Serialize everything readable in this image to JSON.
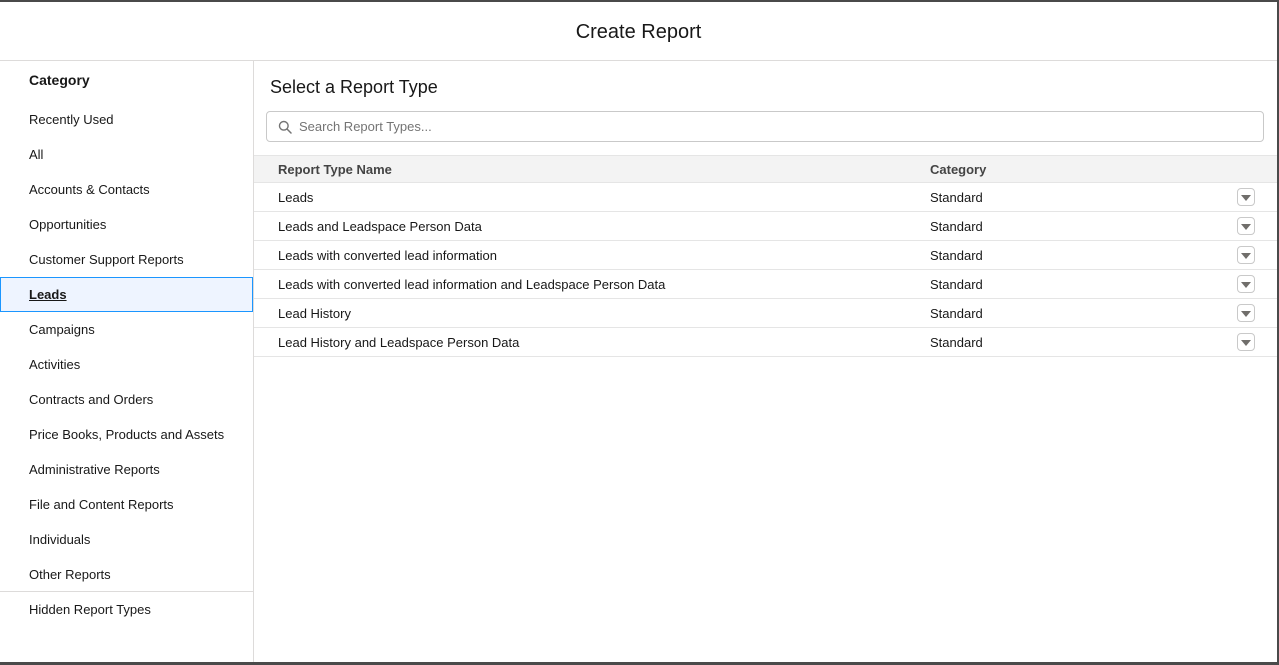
{
  "modal": {
    "title": "Create Report"
  },
  "sidebar": {
    "heading": "Category",
    "items": [
      {
        "label": "Recently Used"
      },
      {
        "label": "All"
      },
      {
        "label": "Accounts & Contacts"
      },
      {
        "label": "Opportunities"
      },
      {
        "label": "Customer Support Reports"
      },
      {
        "label": "Leads",
        "selected": true
      },
      {
        "label": "Campaigns"
      },
      {
        "label": "Activities"
      },
      {
        "label": "Contracts and Orders"
      },
      {
        "label": "Price Books, Products and Assets"
      },
      {
        "label": "Administrative Reports"
      },
      {
        "label": "File and Content Reports"
      },
      {
        "label": "Individuals"
      },
      {
        "label": "Other Reports"
      }
    ],
    "hidden_item": {
      "label": "Hidden Report Types"
    }
  },
  "main": {
    "title": "Select a Report Type",
    "search": {
      "placeholder": "Search Report Types...",
      "value": ""
    },
    "table": {
      "columns": [
        "Report Type Name",
        "Category"
      ],
      "rows": [
        {
          "name": "Leads",
          "category": "Standard"
        },
        {
          "name": "Leads and Leadspace Person Data",
          "category": "Standard"
        },
        {
          "name": "Leads with converted lead information",
          "category": "Standard"
        },
        {
          "name": "Leads with converted lead information and Leadspace Person Data",
          "category": "Standard"
        },
        {
          "name": "Lead History",
          "category": "Standard"
        },
        {
          "name": "Lead History and Leadspace Person Data",
          "category": "Standard"
        }
      ]
    }
  },
  "icons": {
    "search": "search-icon",
    "row_menu": "chevron-down-icon"
  },
  "colors": {
    "selected_border": "#1b96ff",
    "selected_background": "#eef4ff",
    "header_background": "#f3f3f3"
  }
}
